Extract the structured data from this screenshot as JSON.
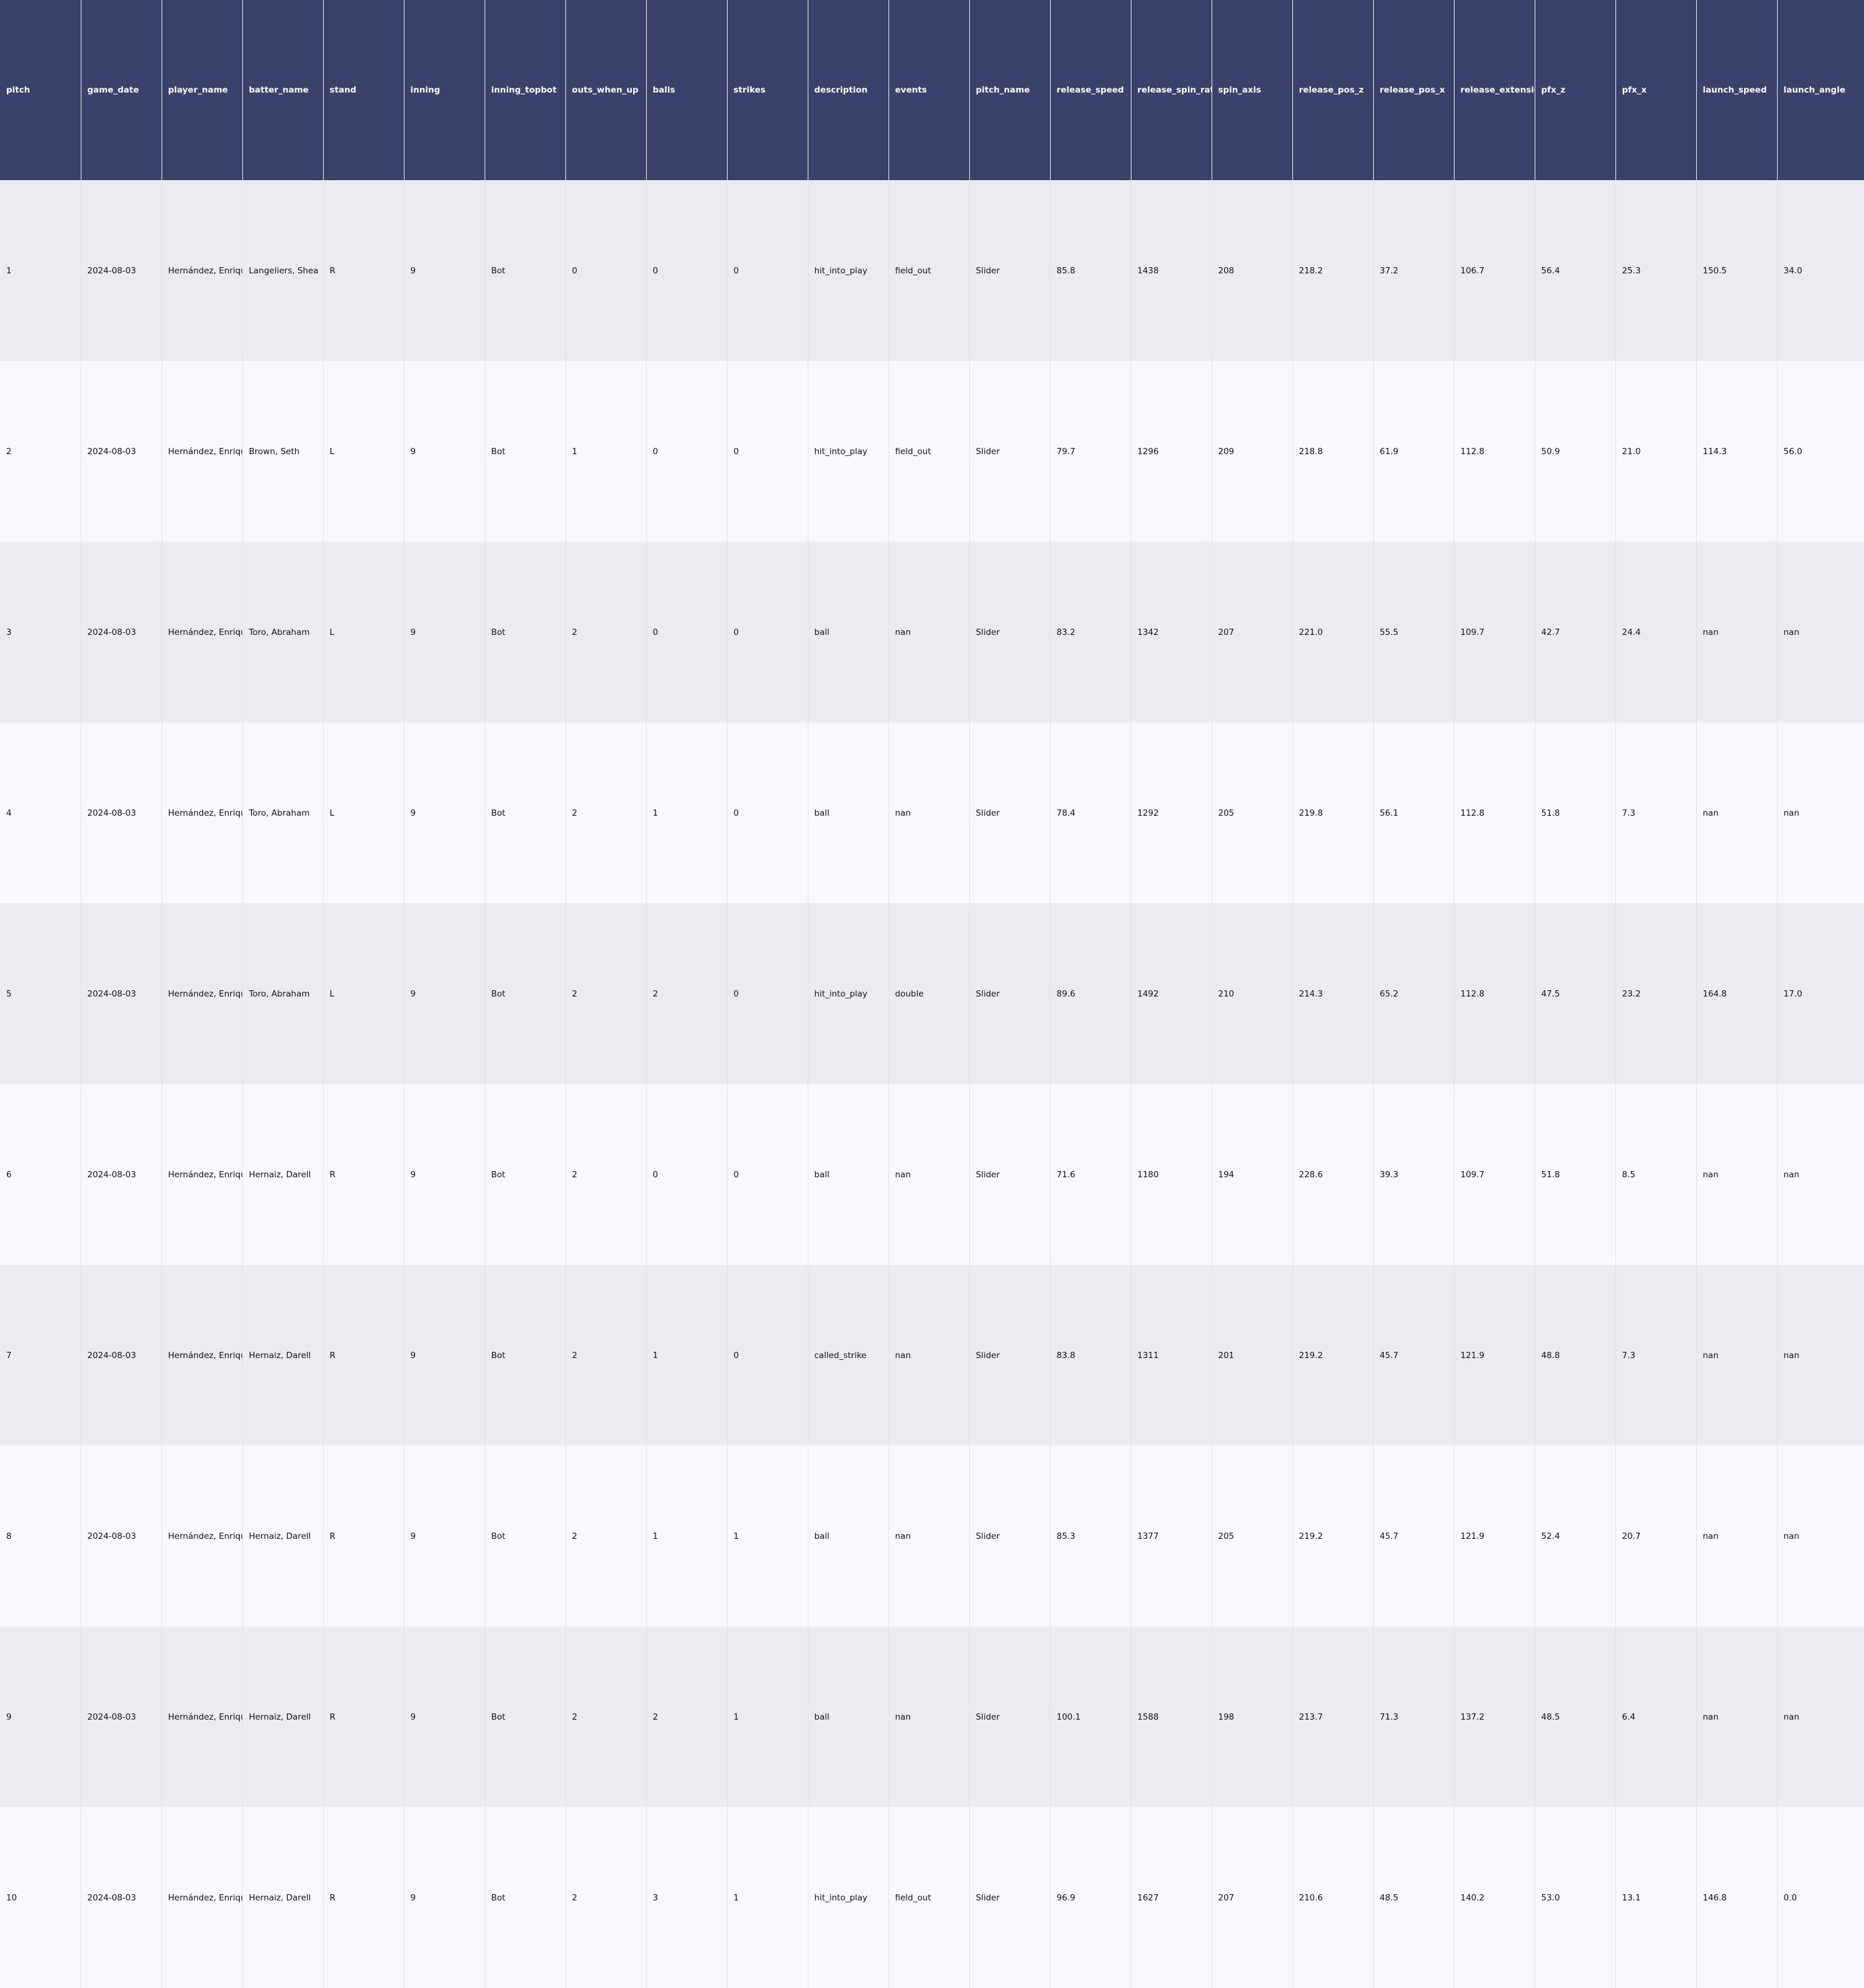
{
  "chart_data": {
    "type": "table",
    "columns": [
      "pitch",
      "game_date",
      "player_name",
      "batter_name",
      "stand",
      "inning",
      "inning_topbot",
      "outs_when_up",
      "balls",
      "strikes",
      "description",
      "events",
      "pitch_name",
      "release_speed",
      "release_spin_rate",
      "spin_axis",
      "release_pos_z",
      "release_pos_x",
      "release_extension",
      "pfx_z",
      "pfx_x",
      "launch_speed",
      "launch_angle"
    ],
    "rows": [
      [
        "1",
        "2024-08-03",
        "Hernández, Enrique",
        "Langeliers, Shea",
        "R",
        "9",
        "Bot",
        "0",
        "0",
        "0",
        "hit_into_play",
        "field_out",
        "Slider",
        "85.8",
        "1438",
        "208",
        "218.2",
        "37.2",
        "106.7",
        "56.4",
        "25.3",
        "150.5",
        "34.0"
      ],
      [
        "2",
        "2024-08-03",
        "Hernández, Enrique",
        "Brown, Seth",
        "L",
        "9",
        "Bot",
        "1",
        "0",
        "0",
        "hit_into_play",
        "field_out",
        "Slider",
        "79.7",
        "1296",
        "209",
        "218.8",
        "61.9",
        "112.8",
        "50.9",
        "21.0",
        "114.3",
        "56.0"
      ],
      [
        "3",
        "2024-08-03",
        "Hernández, Enrique",
        "Toro, Abraham",
        "L",
        "9",
        "Bot",
        "2",
        "0",
        "0",
        "ball",
        "nan",
        "Slider",
        "83.2",
        "1342",
        "207",
        "221.0",
        "55.5",
        "109.7",
        "42.7",
        "24.4",
        "nan",
        "nan"
      ],
      [
        "4",
        "2024-08-03",
        "Hernández, Enrique",
        "Toro, Abraham",
        "L",
        "9",
        "Bot",
        "2",
        "1",
        "0",
        "ball",
        "nan",
        "Slider",
        "78.4",
        "1292",
        "205",
        "219.8",
        "56.1",
        "112.8",
        "51.8",
        "7.3",
        "nan",
        "nan"
      ],
      [
        "5",
        "2024-08-03",
        "Hernández, Enrique",
        "Toro, Abraham",
        "L",
        "9",
        "Bot",
        "2",
        "2",
        "0",
        "hit_into_play",
        "double",
        "Slider",
        "89.6",
        "1492",
        "210",
        "214.3",
        "65.2",
        "112.8",
        "47.5",
        "23.2",
        "164.8",
        "17.0"
      ],
      [
        "6",
        "2024-08-03",
        "Hernández, Enrique",
        "Hernaiz, Darell",
        "R",
        "9",
        "Bot",
        "2",
        "0",
        "0",
        "ball",
        "nan",
        "Slider",
        "71.6",
        "1180",
        "194",
        "228.6",
        "39.3",
        "109.7",
        "51.8",
        "8.5",
        "nan",
        "nan"
      ],
      [
        "7",
        "2024-08-03",
        "Hernández, Enrique",
        "Hernaiz, Darell",
        "R",
        "9",
        "Bot",
        "2",
        "1",
        "0",
        "called_strike",
        "nan",
        "Slider",
        "83.8",
        "1311",
        "201",
        "219.2",
        "45.7",
        "121.9",
        "48.8",
        "7.3",
        "nan",
        "nan"
      ],
      [
        "8",
        "2024-08-03",
        "Hernández, Enrique",
        "Hernaiz, Darell",
        "R",
        "9",
        "Bot",
        "2",
        "1",
        "1",
        "ball",
        "nan",
        "Slider",
        "85.3",
        "1377",
        "205",
        "219.2",
        "45.7",
        "121.9",
        "52.4",
        "20.7",
        "nan",
        "nan"
      ],
      [
        "9",
        "2024-08-03",
        "Hernández, Enrique",
        "Hernaiz, Darell",
        "R",
        "9",
        "Bot",
        "2",
        "2",
        "1",
        "ball",
        "nan",
        "Slider",
        "100.1",
        "1588",
        "198",
        "213.7",
        "71.3",
        "137.2",
        "48.5",
        "6.4",
        "nan",
        "nan"
      ],
      [
        "10",
        "2024-08-03",
        "Hernández, Enrique",
        "Hernaiz, Darell",
        "R",
        "9",
        "Bot",
        "2",
        "3",
        "1",
        "hit_into_play",
        "field_out",
        "Slider",
        "96.9",
        "1627",
        "207",
        "210.6",
        "48.5",
        "140.2",
        "53.0",
        "13.1",
        "146.8",
        "0.0"
      ]
    ],
    "colors": {
      "header_background": "#3a426c",
      "header_text": "#ffffff",
      "row_odd": "#ebecef",
      "row_even": "#f7f9fc",
      "cell_text": "#111111"
    }
  }
}
